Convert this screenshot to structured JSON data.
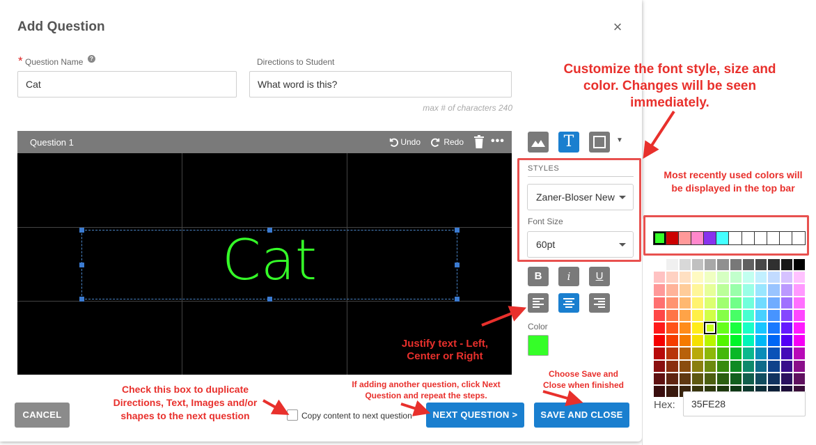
{
  "dialog": {
    "title": "Add Question",
    "close_icon": "×"
  },
  "fields": {
    "required_star": "*",
    "question_name_label": "Question Name",
    "help_icon": "?",
    "question_name_value": "Cat",
    "directions_label": "Directions to Student",
    "directions_value": "What word is this?",
    "max_chars": "max # of characters 240"
  },
  "editor": {
    "header_title": "Question 1",
    "undo_label": "Undo",
    "redo_label": "Redo",
    "more_icon": "•••",
    "canvas_text": "Cat",
    "canvas_text_color": "#35FE28"
  },
  "tools": {
    "text_tool_glyph": "T",
    "shape_caret": "▼",
    "styles_label": "STYLES",
    "font_value": "Zaner-Bloser New",
    "font_size_label": "Font Size",
    "font_size_value": "60pt",
    "bold": "B",
    "italic": "i",
    "underline": "U",
    "color_label": "Color",
    "color_value": "#35FE28"
  },
  "footer": {
    "cancel_label": "CANCEL",
    "copy_label": "Copy content to next question",
    "next_label": "NEXT QUESTION >",
    "save_label": "SAVE AND CLOSE"
  },
  "picker": {
    "recent_colors": [
      "#35FE28",
      "#cc0000",
      "#ff9999",
      "#ff88cc",
      "#8833ee",
      "#44ffff",
      "#ffffff",
      "#ffffff",
      "#ffffff",
      "#ffffff",
      "#ffffff",
      "#ffffff"
    ],
    "hex_label": "Hex:",
    "hex_value": "35FE28"
  },
  "annotations": {
    "customize": "Customize the font style, size and color. Changes will be seen immediately.",
    "recent": "Most recently used colors will be displayed in the top bar",
    "justify": "Justify text - Left, Center or Right",
    "save": "Choose Save and Close when finished",
    "next": "If adding another question, click Next Question and repeat the steps.",
    "copy": "Check this box to duplicate Directions, Text, Images and/or shapes to the next question"
  },
  "colors": {
    "accent": "#1a7fcf",
    "annotation": "#e8302c"
  }
}
